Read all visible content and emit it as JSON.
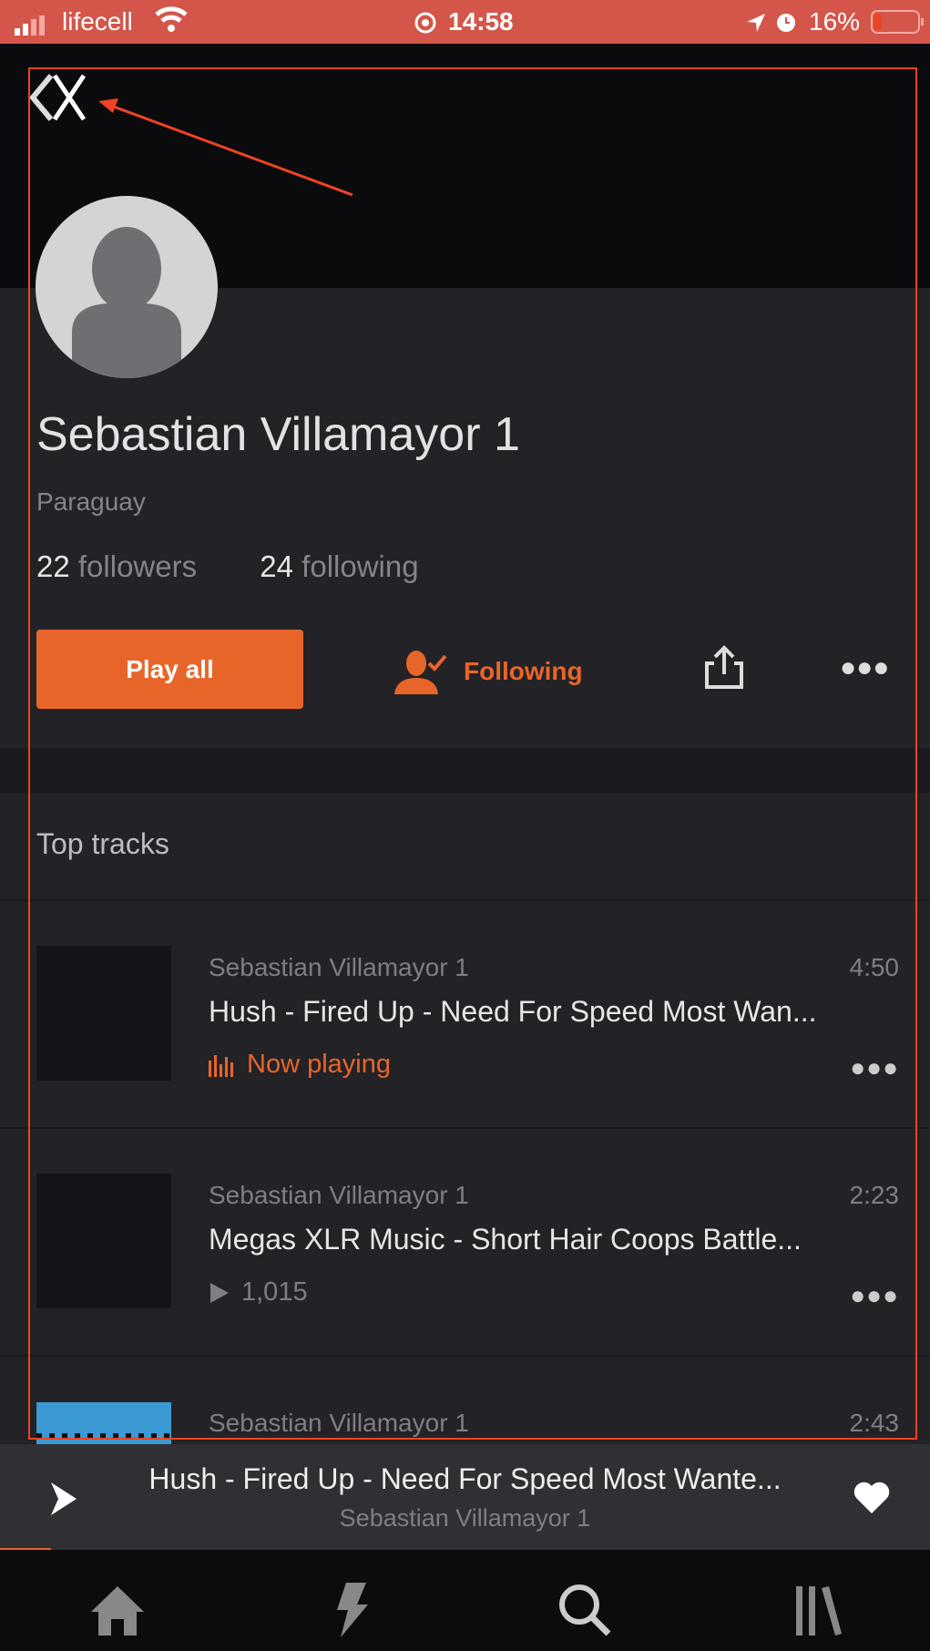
{
  "status_bar": {
    "carrier": "lifecell",
    "time": "14:58",
    "battery": "16%"
  },
  "profile": {
    "name": "Sebastian Villamayor 1",
    "country": "Paraguay",
    "followers_count": "22",
    "followers_label": "followers",
    "following_count": "24",
    "following_label": "following"
  },
  "actions": {
    "play_all": "Play all",
    "following": "Following"
  },
  "section": {
    "title": "Top tracks"
  },
  "tracks": [
    {
      "artist": "Sebastian Villamayor 1",
      "duration": "4:50",
      "title": "Hush - Fired Up - Need For Speed Most Wan...",
      "status": "Now playing"
    },
    {
      "artist": "Sebastian Villamayor 1",
      "duration": "2:23",
      "title": "Megas XLR Music - Short Hair Coops Battle...",
      "plays": "1,015"
    },
    {
      "artist": "Sebastian Villamayor 1",
      "duration": "2:43"
    }
  ],
  "mini_player": {
    "title": "Hush - Fired Up - Need For Speed Most Wante...",
    "artist": "Sebastian Villamayor 1",
    "progress_percent": 5
  },
  "nav": [
    "home-icon",
    "stream-icon",
    "search-icon",
    "library-icon"
  ],
  "colors": {
    "accent": "#e8652a",
    "status_bar": "#d4554a",
    "annotation": "#ee4423"
  }
}
